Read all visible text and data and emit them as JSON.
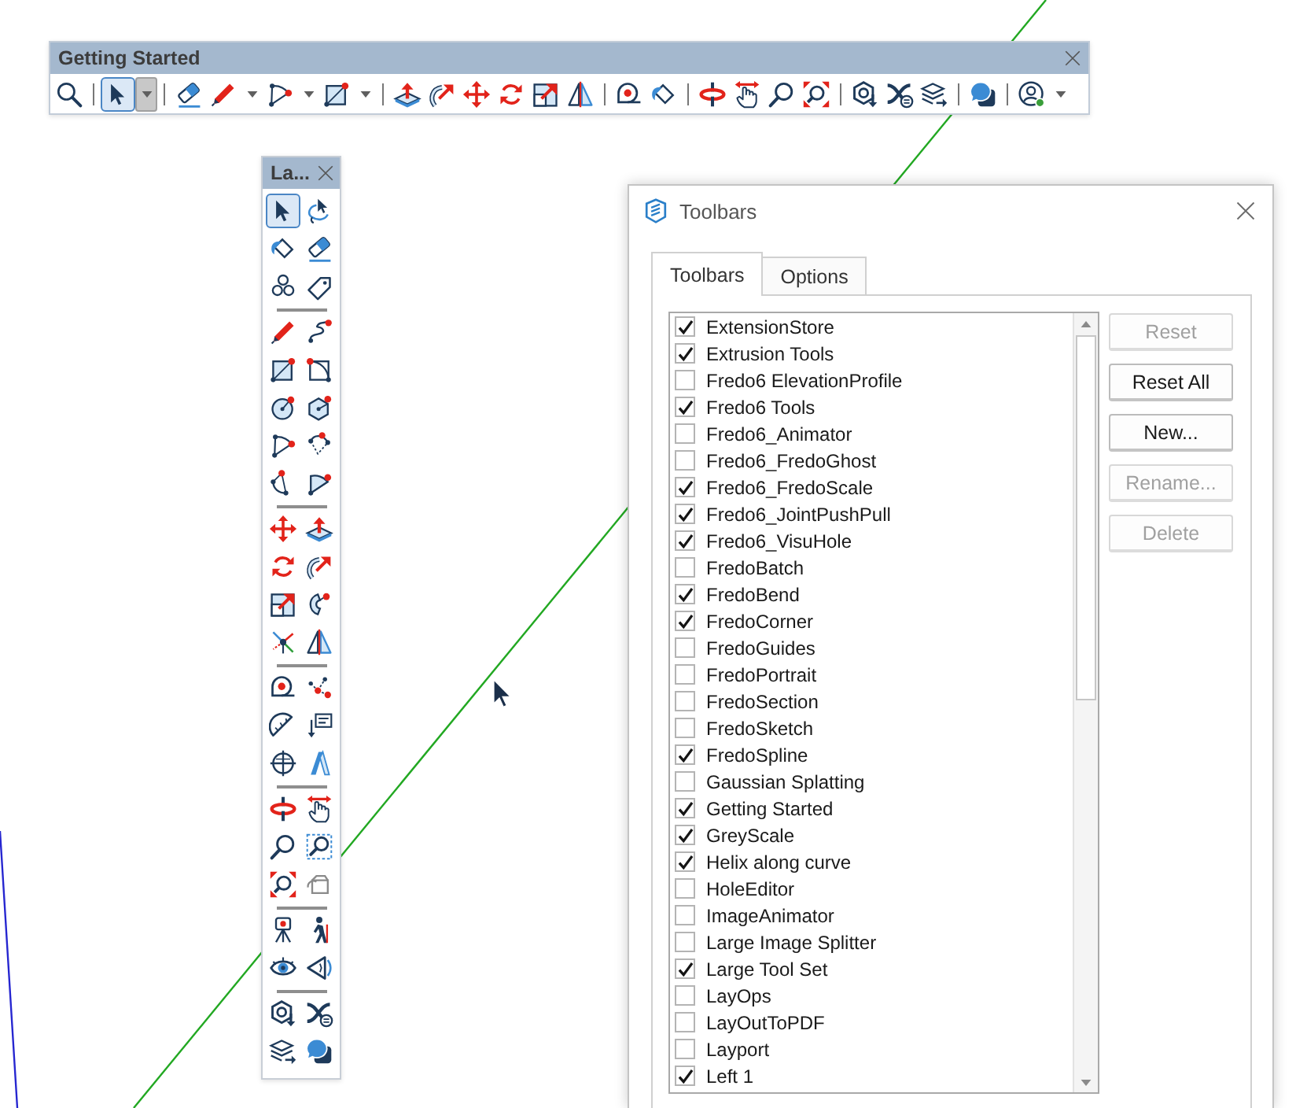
{
  "toolbar": {
    "title": "Getting Started",
    "groups": [
      [
        {
          "selected": false,
          "menu": false
        }
      ],
      [
        {
          "selected": true,
          "menu": true
        }
      ],
      [
        {
          "selected": false,
          "menu": false
        },
        {
          "selected": false,
          "menu": true
        },
        {
          "selected": false,
          "menu": true
        },
        {
          "selected": false,
          "menu": true
        }
      ],
      [
        {
          "selected": false,
          "menu": false
        },
        {
          "selected": false,
          "menu": false
        },
        {
          "selected": false,
          "menu": false
        },
        {
          "selected": false,
          "menu": false
        },
        {
          "selected": false,
          "menu": false
        },
        {
          "selected": false,
          "menu": false
        }
      ],
      [
        {
          "selected": false,
          "menu": false
        },
        {
          "selected": false,
          "menu": false
        }
      ],
      [
        {
          "selected": false,
          "menu": false
        },
        {
          "selected": false,
          "menu": false
        },
        {
          "selected": false,
          "menu": false
        },
        {
          "selected": false,
          "menu": false
        }
      ],
      [
        {
          "selected": false,
          "menu": false
        },
        {
          "selected": false,
          "menu": false
        },
        {
          "selected": false,
          "menu": false
        }
      ],
      [
        {
          "selected": false,
          "menu": false
        }
      ],
      [
        {
          "selected": false,
          "menu": true
        }
      ]
    ]
  },
  "palette": {
    "title": "La...",
    "groups": [
      [
        {
          "selected": true
        },
        {
          "selected": false
        },
        {
          "selected": false
        },
        {
          "selected": false
        },
        {
          "selected": false
        },
        {
          "selected": false
        }
      ],
      [
        {
          "selected": false
        },
        {
          "selected": false
        },
        {
          "selected": false
        },
        {
          "selected": false
        },
        {
          "selected": false
        },
        {
          "selected": false
        },
        {
          "selected": false
        },
        {
          "selected": false
        },
        {
          "selected": false
        },
        {
          "selected": false
        }
      ],
      [
        {
          "selected": false
        },
        {
          "selected": false
        },
        {
          "selected": false
        },
        {
          "selected": false
        },
        {
          "selected": false
        },
        {
          "selected": false
        },
        {
          "selected": false
        },
        {
          "selected": false
        }
      ],
      [
        {
          "selected": false
        },
        {
          "selected": false
        },
        {
          "selected": false
        },
        {
          "selected": false
        },
        {
          "selected": false
        },
        {
          "selected": false
        }
      ],
      [
        {
          "selected": false
        },
        {
          "selected": false
        },
        {
          "selected": false
        },
        {
          "selected": false
        },
        {
          "selected": false
        },
        {
          "selected": false
        }
      ],
      [
        {
          "selected": false
        },
        {
          "selected": false
        },
        {
          "selected": false
        },
        {
          "selected": false
        }
      ],
      [
        {
          "selected": false
        },
        {
          "selected": false
        },
        {
          "selected": false
        },
        {
          "selected": false
        }
      ]
    ]
  },
  "dialog": {
    "title": "Toolbars",
    "tabs": [
      {
        "label": "Toolbars",
        "selected": true
      },
      {
        "label": "Options",
        "selected": false
      }
    ],
    "list": [
      {
        "label": "ExtensionStore",
        "checked": true
      },
      {
        "label": "Extrusion Tools",
        "checked": true
      },
      {
        "label": "Fredo6 ElevationProfile",
        "checked": false
      },
      {
        "label": "Fredo6 Tools",
        "checked": true
      },
      {
        "label": "Fredo6_Animator",
        "checked": false
      },
      {
        "label": "Fredo6_FredoGhost",
        "checked": false
      },
      {
        "label": "Fredo6_FredoScale",
        "checked": true
      },
      {
        "label": "Fredo6_JointPushPull",
        "checked": true
      },
      {
        "label": "Fredo6_VisuHole",
        "checked": true
      },
      {
        "label": "FredoBatch",
        "checked": false
      },
      {
        "label": "FredoBend",
        "checked": true
      },
      {
        "label": "FredoCorner",
        "checked": true
      },
      {
        "label": "FredoGuides",
        "checked": false
      },
      {
        "label": "FredoPortrait",
        "checked": false
      },
      {
        "label": "FredoSection",
        "checked": false
      },
      {
        "label": "FredoSketch",
        "checked": false
      },
      {
        "label": "FredoSpline",
        "checked": true
      },
      {
        "label": "Gaussian Splatting",
        "checked": false
      },
      {
        "label": "Getting Started",
        "checked": true
      },
      {
        "label": "GreyScale",
        "checked": true
      },
      {
        "label": "Helix along curve",
        "checked": true
      },
      {
        "label": "HoleEditor",
        "checked": false
      },
      {
        "label": "ImageAnimator",
        "checked": false
      },
      {
        "label": "Large Image Splitter",
        "checked": false
      },
      {
        "label": "Large Tool Set",
        "checked": true
      },
      {
        "label": "LayOps",
        "checked": false
      },
      {
        "label": "LayOutToPDF",
        "checked": false
      },
      {
        "label": "Layport",
        "checked": false
      },
      {
        "label": "Left 1",
        "checked": true
      }
    ],
    "buttons": [
      {
        "label": "Reset",
        "disabled": true
      },
      {
        "label": "Reset All",
        "disabled": false
      },
      {
        "label": "New...",
        "disabled": false
      },
      {
        "label": "Rename...",
        "disabled": true
      },
      {
        "label": "Delete",
        "disabled": true
      }
    ]
  }
}
